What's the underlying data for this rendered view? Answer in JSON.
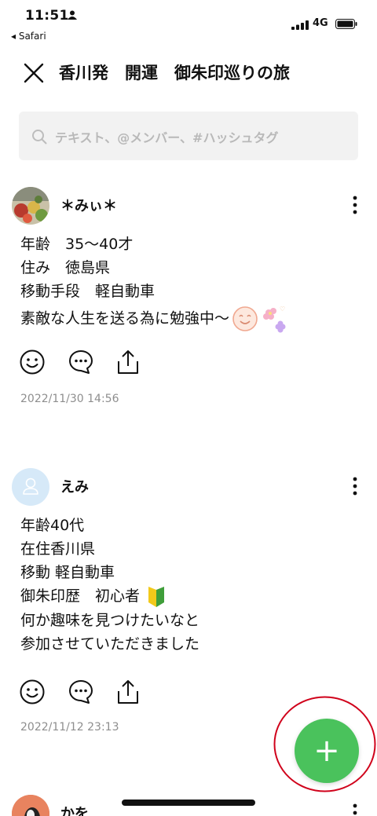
{
  "status_bar": {
    "time": "11:51",
    "back_app": "◂ Safari",
    "network": "4G"
  },
  "header": {
    "title": "香川発　開運　御朱印巡りの旅"
  },
  "search": {
    "placeholder": "テキスト、@メンバー、#ハッシュタグ"
  },
  "posts": [
    {
      "username": "＊みぃ＊",
      "lines": [
        "年齢　35〜40才",
        "住み　徳島県",
        "移動手段　軽自動車",
        "素敵な人生を送る為に勉強中〜"
      ],
      "timestamp": "2022/11/30 14:56"
    },
    {
      "username": "えみ",
      "lines": [
        "年齢40代",
        "在住香川県",
        "移動 軽自動車",
        "御朱印歴　初心者",
        "何か趣味を見つけたいなと",
        "参加させていただきました"
      ],
      "timestamp": "2022/11/12 23:13"
    },
    {
      "username": "かを"
    }
  ],
  "colors": {
    "accent_green": "#4ac25c",
    "annotation_red": "#d0021b",
    "timestamp_gray": "#8e8e8e"
  }
}
